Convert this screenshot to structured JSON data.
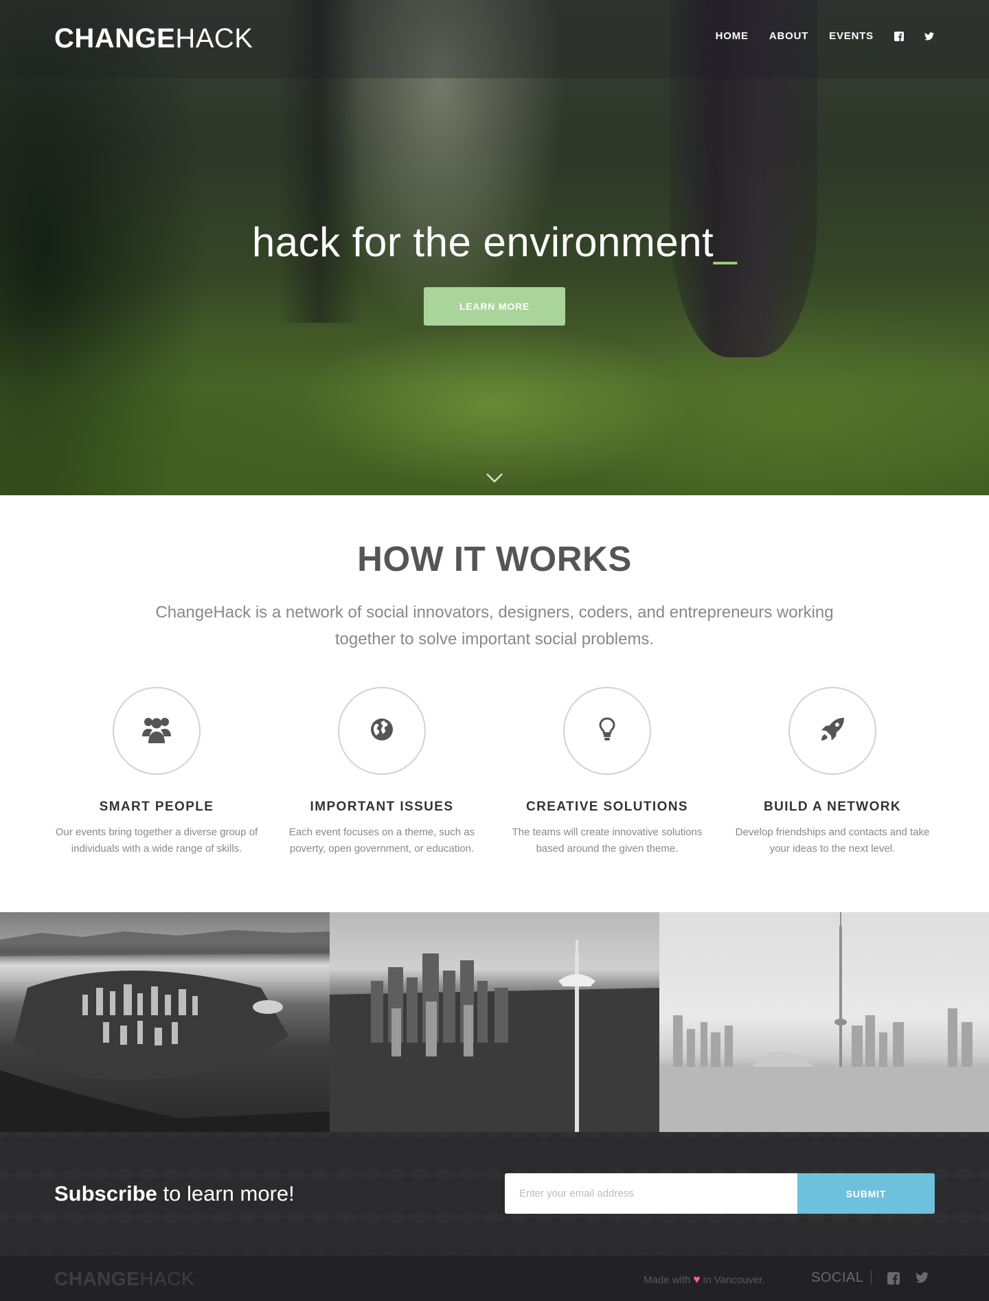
{
  "nav": {
    "logo_bold": "CHANGE",
    "logo_light": "HACK",
    "items": [
      {
        "label": "HOME"
      },
      {
        "label": "ABOUT"
      },
      {
        "label": "EVENTS"
      }
    ],
    "social_icons": [
      "facebook-icon",
      "twitter-icon"
    ]
  },
  "hero": {
    "headline": "hack for the environment",
    "cursor": "_",
    "button": "LEARN MORE",
    "scroll_icon": "chevron-down-icon"
  },
  "how": {
    "title": "HOW IT WORKS",
    "description": "ChangeHack is a network of social innovators, designers, coders, and entrepreneurs working together to solve important social problems.",
    "features": [
      {
        "icon": "group-icon",
        "title": "SMART PEOPLE",
        "text": "Our events bring together a diverse group of individuals with a wide range of skills."
      },
      {
        "icon": "globe-icon",
        "title": "IMPORTANT ISSUES",
        "text": "Each event focuses on a theme, such as poverty, open government, or education."
      },
      {
        "icon": "lightbulb-icon",
        "title": "CREATIVE SOLUTIONS",
        "text": "The teams will create innovative solutions based around the given theme."
      },
      {
        "icon": "rocket-icon",
        "title": "BUILD A NETWORK",
        "text": "Develop friendships and contacts and take your ideas to the next level."
      }
    ]
  },
  "subscribe": {
    "bold": "Subscribe",
    "rest": " to learn more!",
    "placeholder": "Enter your email address",
    "button": "SUBMIT"
  },
  "footer": {
    "logo_bold": "CHANGE",
    "logo_light": "HACK",
    "made_before": "Made with ",
    "heart": "♥",
    "made_after": " in Vancouver.",
    "social_label": "SOCIAL"
  },
  "colors": {
    "accent_green": "#a9d59a",
    "cursor_green": "#9ed07a",
    "submit_blue": "#6ec1dd",
    "heart_pink": "#ff5ba3",
    "footer_bg": "#222224"
  }
}
